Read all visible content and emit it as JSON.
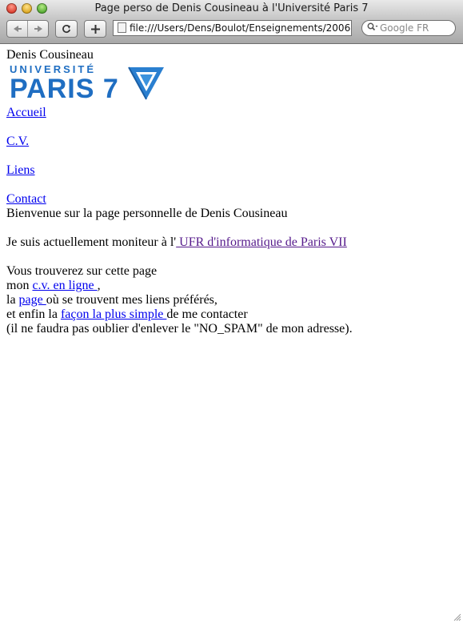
{
  "window": {
    "title": "Page perso de Denis Cousineau à l'Université Paris 7"
  },
  "toolbar": {
    "back_icon": "back-arrow-icon",
    "forward_icon": "forward-arrow-icon",
    "reload_icon": "reload-icon",
    "add_icon": "plus-icon",
    "url": "file:///Users/Dens/Boulot/Enseignements/2006",
    "search_placeholder": "Google FR"
  },
  "page": {
    "name": "Denis Cousineau",
    "logo": {
      "small": "UNIVERSITÉ",
      "big": "PARIS 7"
    },
    "nav": [
      {
        "label": "Accueil "
      },
      {
        "label": "C.V. "
      },
      {
        "label": "Liens "
      },
      {
        "label": "Contact"
      }
    ],
    "welcome": "Bienvenue sur la page personnelle de Denis Cousineau",
    "moniteur": {
      "prefix": "Je suis actuellement moniteur à l'",
      "link": " UFR d'informatique de Paris VII "
    },
    "intro": "Vous trouverez sur cette page",
    "line_cv": {
      "prefix": "mon ",
      "link": "c.v. en ligne ",
      "suffix": ","
    },
    "line_page": {
      "prefix": "la ",
      "link": "page ",
      "suffix": "où se trouvent mes liens préférés,"
    },
    "line_contact": {
      "prefix": "et enfin la ",
      "link": "façon la plus simple ",
      "suffix": "de me contacter"
    },
    "note": "(il ne faudra pas oublier d'enlever le \"NO_SPAM\" de mon adresse)."
  },
  "colors": {
    "link": "#0000ee",
    "visited_link": "#551a8b",
    "logo_blue": "#1f6ec2"
  }
}
